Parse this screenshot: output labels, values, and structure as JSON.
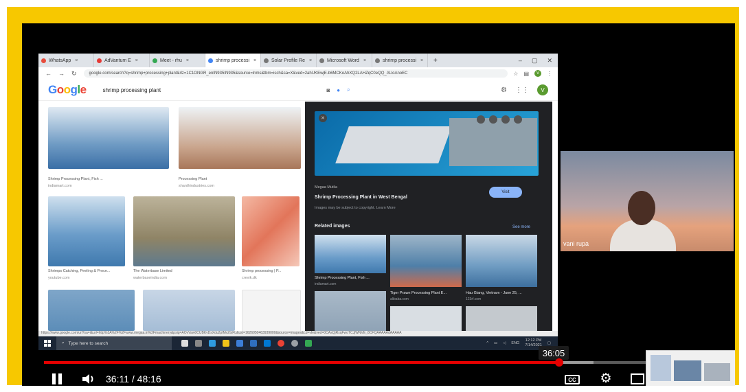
{
  "browser": {
    "tabs": [
      {
        "label": "WhatsApp",
        "color": "#e74c3c"
      },
      {
        "label": "AdVantum E",
        "color": "#e53935"
      },
      {
        "label": "Meet - rhu",
        "color": "#34a853"
      },
      {
        "label": "shrimp processi",
        "color": "#4285f4"
      },
      {
        "label": "Solar Profile Re",
        "color": "#777777"
      },
      {
        "label": "Microsoft Word",
        "color": "#777777"
      },
      {
        "label": "shrimp processi",
        "color": "#777777"
      }
    ],
    "url": "google.com/search?q=shrimp+processing+plant&rlz=1C1ONGR_enIN935IN935&source=lnms&tbm=isch&sa=X&ved=2ahUKEwjE-b6MCKoAhXQ2LAHZqC0eQQ_AUoAnoEC"
  },
  "google": {
    "logo": [
      "G",
      "o",
      "o",
      "g",
      "l",
      "e"
    ],
    "query": "shrimp processing plant",
    "avatar_letter": "V"
  },
  "results": [
    {
      "title": "Shrimp Processing Plant, Fish ...",
      "source": "indiamart.com"
    },
    {
      "title": "Processing Plant",
      "source": "shanthindustries.com"
    },
    {
      "title": "Shrimps Catching, Peeling & Proce...",
      "source": "youtube.com"
    },
    {
      "title": "The Waterbase Limited",
      "source": "waterbaseindia.com"
    },
    {
      "title": "Shrimp processing | P...",
      "source": "crevik.dk"
    }
  ],
  "preview": {
    "source": "Megaa Mutlia",
    "title": "Shrimp Processing Plant in West Bengal",
    "copyright": "Images may be subject to copyright. Learn More",
    "visit_label": "Visit",
    "related_label": "Related images",
    "see_more": "See more",
    "related": [
      {
        "title": "Shrimp Processing Plant, Fish ...",
        "source": "indiamart.com"
      },
      {
        "title": "Tiger Prawn Processing Plant E...",
        "source": "alibaba.com"
      },
      {
        "title": "Hau Giang, Vietnam - June 25, ...",
        "source": "123rf.com"
      }
    ]
  },
  "status_url": "https://www.google.com/url?sa=i&url=http%3A%2F%2Fwww.megaa.in%2Fmachinery&psig=AOvVaw0CUBKvDsXdu2pIMvZtxFL&ust=1626950463939000&source=images&cd=vfe&ved=0CAsQjRxqFwoTCJjWNVE_8CFQAAAAAdAAAAA",
  "taskbar": {
    "search_placeholder": "Type here to search",
    "clock_time": "12:12 PM",
    "clock_date": "7/14/2021",
    "lang": "ENG"
  },
  "participant": {
    "name": "vani rupa"
  },
  "player": {
    "hover_time": "36:05",
    "current_time": "36:11",
    "separator": " / ",
    "duration": "48:16",
    "progress_fraction": 0.7497,
    "buffer_fraction": 0.8,
    "cc_label": "CC"
  },
  "colors": {
    "frame": "#f7c800",
    "progress": "#e60000",
    "google_blue": "#4285f4"
  }
}
